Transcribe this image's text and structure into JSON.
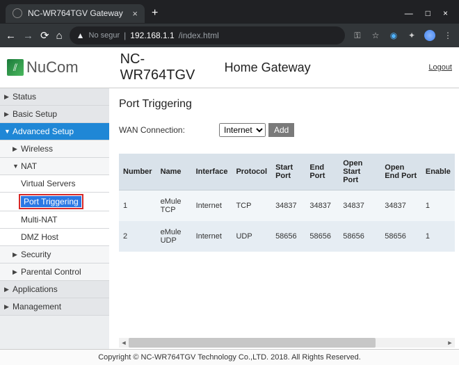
{
  "browser": {
    "tab_title": "NC-WR764TGV Gateway",
    "security_label": "No segur",
    "url_host": "192.168.1.1",
    "url_path": "/index.html"
  },
  "header": {
    "brand": "NuCom",
    "model": "NC-WR764TGV",
    "subtitle": "Home Gateway",
    "logout": "Logout"
  },
  "sidebar": {
    "status": "Status",
    "basic_setup": "Basic Setup",
    "advanced_setup": "Advanced Setup",
    "wireless": "Wireless",
    "nat": "NAT",
    "virtual_servers": "Virtual Servers",
    "port_triggering": "Port Triggering",
    "multi_nat": "Multi-NAT",
    "dmz_host": "DMZ Host",
    "security": "Security",
    "parental_control": "Parental Control",
    "applications": "Applications",
    "management": "Management"
  },
  "content": {
    "title": "Port Triggering",
    "wan_label": "WAN Connection:",
    "wan_selected": "Internet",
    "add_label": "Add",
    "columns": {
      "number": "Number",
      "name": "Name",
      "interface": "Interface",
      "protocol": "Protocol",
      "start_port": "Start Port",
      "end_port": "End Port",
      "open_start_port": "Open Start Port",
      "open_end_port": "Open End Port",
      "enable": "Enable"
    },
    "rows": [
      {
        "number": "1",
        "name": "eMule TCP",
        "interface": "Internet",
        "protocol": "TCP",
        "start_port": "34837",
        "end_port": "34837",
        "open_start_port": "34837",
        "open_end_port": "34837",
        "enable": "1"
      },
      {
        "number": "2",
        "name": "eMule UDP",
        "interface": "Internet",
        "protocol": "UDP",
        "start_port": "58656",
        "end_port": "58656",
        "open_start_port": "58656",
        "open_end_port": "58656",
        "enable": "1"
      }
    ]
  },
  "footer": {
    "text": "Copyright © NC-WR764TGV Technology Co.,LTD. 2018. All Rights Reserved."
  }
}
